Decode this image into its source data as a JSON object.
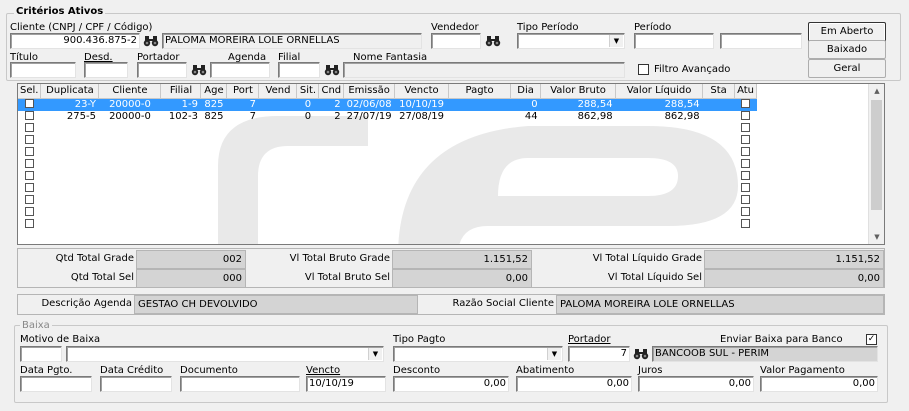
{
  "criterios": {
    "title": "Critérios Ativos",
    "cliente_label": "Cliente (CNPJ / CPF / Código)",
    "cliente_code": "900.436.875-2",
    "cliente_name": "PALOMA MOREIRA LOLE ORNELLAS",
    "vendedor_label": "Vendedor",
    "vendedor_value": "",
    "tipo_periodo_label": "Tipo Período",
    "tipo_periodo_value": "",
    "periodo_label": "Período",
    "periodo_from": "",
    "periodo_to": "",
    "titulo_label": "Título",
    "titulo_value": "",
    "desd_label": "Desd.",
    "desd_value": "",
    "portador_label": "Portador",
    "portador_value": "",
    "agenda_label": "Agenda",
    "agenda_value": "",
    "filial_label": "Filial",
    "filial_value": "",
    "nome_fantasia_label": "Nome Fantasia",
    "nome_fantasia_value": "",
    "filtro_avancado_label": "Filtro Avançado"
  },
  "buttons": {
    "em_aberto": "Em Aberto",
    "baixado": "Baixado",
    "geral": "Geral"
  },
  "grid": {
    "columns": [
      "Sel.",
      "Duplicata",
      "Cliente",
      "Filial",
      "Age",
      "Port",
      "Vend",
      "Sit.",
      "Cnd",
      "Emissão",
      "Vencto",
      "Pagto",
      "Dia",
      "Valor Bruto",
      "Valor Líquido",
      "Sta",
      "Atu"
    ],
    "rows": [
      {
        "duplicata": "23-Y",
        "cliente": "20000-0",
        "filial": "1-9",
        "age": "825",
        "port": "7",
        "vend": "",
        "sit": "0",
        "cnd": "2",
        "emissao": "02/06/08",
        "vencto": "10/10/19",
        "pagto": "",
        "dia": "0",
        "bruto": "288,54",
        "liquido": "288,54",
        "sta": ""
      },
      {
        "duplicata": "275-5",
        "cliente": "20000-0",
        "filial": "102-3",
        "age": "825",
        "port": "7",
        "vend": "",
        "sit": "0",
        "cnd": "2",
        "emissao": "27/07/19",
        "vencto": "27/08/19",
        "pagto": "",
        "dia": "44",
        "bruto": "862,98",
        "liquido": "862,98",
        "sta": ""
      }
    ],
    "empty_rows": 9
  },
  "totals": {
    "qtd_total_grade_label": "Qtd Total Grade",
    "qtd_total_grade": "002",
    "vl_bruto_grade_label": "Vl Total Bruto Grade",
    "vl_bruto_grade": "1.151,52",
    "vl_liquido_grade_label": "Vl Total Líquido Grade",
    "vl_liquido_grade": "1.151,52",
    "qtd_total_sel_label": "Qtd Total Sel",
    "qtd_total_sel": "000",
    "vl_bruto_sel_label": "Vl Total Bruto Sel",
    "vl_bruto_sel": "0,00",
    "vl_liquido_sel_label": "Vl Total Líquido Sel",
    "vl_liquido_sel": "0,00"
  },
  "info": {
    "descricao_agenda_label": "Descrição Agenda",
    "descricao_agenda": "GESTAO CH DEVOLVIDO",
    "razao_social_label": "Razão Social Cliente",
    "razao_social": "PALOMA MOREIRA LOLE ORNELLAS"
  },
  "baixa": {
    "title": "Baixa",
    "motivo_label": "Motivo de Baixa",
    "motivo_code": "",
    "motivo_value": "",
    "tipo_pagto_label": "Tipo Pagto",
    "tipo_pagto_value": "",
    "portador_label": "Portador",
    "portador_code": "7",
    "portador_name": "BANCOOB SUL - PERIM",
    "enviar_banco_label": "Enviar Baixa para Banco",
    "data_pgto_label": "Data Pgto.",
    "data_pgto": "",
    "data_credito_label": "Data Crédito",
    "data_credito": "",
    "documento_label": "Documento",
    "documento": "",
    "vencto_label": "Vencto",
    "vencto": "10/10/19",
    "desconto_label": "Desconto",
    "desconto": "0,00",
    "abatimento_label": "Abatimento",
    "abatimento": "0,00",
    "juros_label": "Juros",
    "juros": "0,00",
    "valor_pagamento_label": "Valor Pagamento",
    "valor_pagamento": "0,00"
  }
}
